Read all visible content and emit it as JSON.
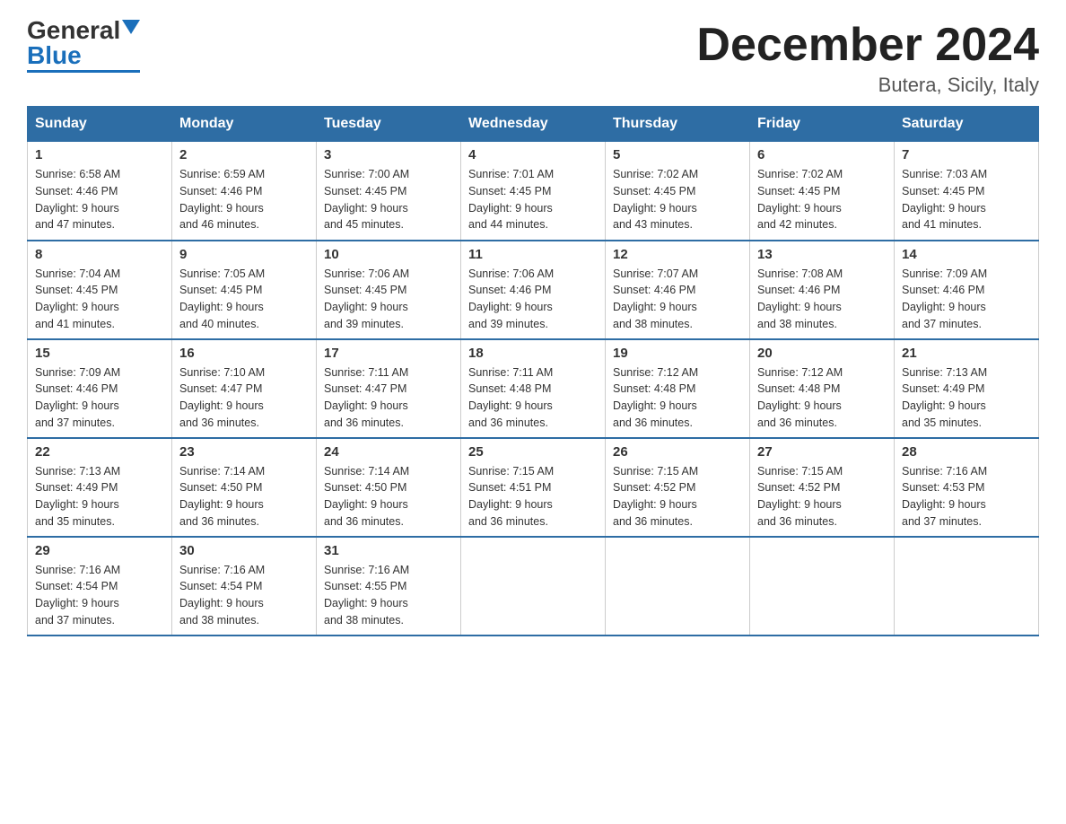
{
  "logo": {
    "general": "General",
    "blue": "Blue"
  },
  "title": "December 2024",
  "subtitle": "Butera, Sicily, Italy",
  "days": [
    "Sunday",
    "Monday",
    "Tuesday",
    "Wednesday",
    "Thursday",
    "Friday",
    "Saturday"
  ],
  "weeks": [
    [
      {
        "num": "1",
        "sunrise": "6:58 AM",
        "sunset": "4:46 PM",
        "daylight": "9 hours and 47 minutes."
      },
      {
        "num": "2",
        "sunrise": "6:59 AM",
        "sunset": "4:46 PM",
        "daylight": "9 hours and 46 minutes."
      },
      {
        "num": "3",
        "sunrise": "7:00 AM",
        "sunset": "4:45 PM",
        "daylight": "9 hours and 45 minutes."
      },
      {
        "num": "4",
        "sunrise": "7:01 AM",
        "sunset": "4:45 PM",
        "daylight": "9 hours and 44 minutes."
      },
      {
        "num": "5",
        "sunrise": "7:02 AM",
        "sunset": "4:45 PM",
        "daylight": "9 hours and 43 minutes."
      },
      {
        "num": "6",
        "sunrise": "7:02 AM",
        "sunset": "4:45 PM",
        "daylight": "9 hours and 42 minutes."
      },
      {
        "num": "7",
        "sunrise": "7:03 AM",
        "sunset": "4:45 PM",
        "daylight": "9 hours and 41 minutes."
      }
    ],
    [
      {
        "num": "8",
        "sunrise": "7:04 AM",
        "sunset": "4:45 PM",
        "daylight": "9 hours and 41 minutes."
      },
      {
        "num": "9",
        "sunrise": "7:05 AM",
        "sunset": "4:45 PM",
        "daylight": "9 hours and 40 minutes."
      },
      {
        "num": "10",
        "sunrise": "7:06 AM",
        "sunset": "4:45 PM",
        "daylight": "9 hours and 39 minutes."
      },
      {
        "num": "11",
        "sunrise": "7:06 AM",
        "sunset": "4:46 PM",
        "daylight": "9 hours and 39 minutes."
      },
      {
        "num": "12",
        "sunrise": "7:07 AM",
        "sunset": "4:46 PM",
        "daylight": "9 hours and 38 minutes."
      },
      {
        "num": "13",
        "sunrise": "7:08 AM",
        "sunset": "4:46 PM",
        "daylight": "9 hours and 38 minutes."
      },
      {
        "num": "14",
        "sunrise": "7:09 AM",
        "sunset": "4:46 PM",
        "daylight": "9 hours and 37 minutes."
      }
    ],
    [
      {
        "num": "15",
        "sunrise": "7:09 AM",
        "sunset": "4:46 PM",
        "daylight": "9 hours and 37 minutes."
      },
      {
        "num": "16",
        "sunrise": "7:10 AM",
        "sunset": "4:47 PM",
        "daylight": "9 hours and 36 minutes."
      },
      {
        "num": "17",
        "sunrise": "7:11 AM",
        "sunset": "4:47 PM",
        "daylight": "9 hours and 36 minutes."
      },
      {
        "num": "18",
        "sunrise": "7:11 AM",
        "sunset": "4:48 PM",
        "daylight": "9 hours and 36 minutes."
      },
      {
        "num": "19",
        "sunrise": "7:12 AM",
        "sunset": "4:48 PM",
        "daylight": "9 hours and 36 minutes."
      },
      {
        "num": "20",
        "sunrise": "7:12 AM",
        "sunset": "4:48 PM",
        "daylight": "9 hours and 36 minutes."
      },
      {
        "num": "21",
        "sunrise": "7:13 AM",
        "sunset": "4:49 PM",
        "daylight": "9 hours and 35 minutes."
      }
    ],
    [
      {
        "num": "22",
        "sunrise": "7:13 AM",
        "sunset": "4:49 PM",
        "daylight": "9 hours and 35 minutes."
      },
      {
        "num": "23",
        "sunrise": "7:14 AM",
        "sunset": "4:50 PM",
        "daylight": "9 hours and 36 minutes."
      },
      {
        "num": "24",
        "sunrise": "7:14 AM",
        "sunset": "4:50 PM",
        "daylight": "9 hours and 36 minutes."
      },
      {
        "num": "25",
        "sunrise": "7:15 AM",
        "sunset": "4:51 PM",
        "daylight": "9 hours and 36 minutes."
      },
      {
        "num": "26",
        "sunrise": "7:15 AM",
        "sunset": "4:52 PM",
        "daylight": "9 hours and 36 minutes."
      },
      {
        "num": "27",
        "sunrise": "7:15 AM",
        "sunset": "4:52 PM",
        "daylight": "9 hours and 36 minutes."
      },
      {
        "num": "28",
        "sunrise": "7:16 AM",
        "sunset": "4:53 PM",
        "daylight": "9 hours and 37 minutes."
      }
    ],
    [
      {
        "num": "29",
        "sunrise": "7:16 AM",
        "sunset": "4:54 PM",
        "daylight": "9 hours and 37 minutes."
      },
      {
        "num": "30",
        "sunrise": "7:16 AM",
        "sunset": "4:54 PM",
        "daylight": "9 hours and 38 minutes."
      },
      {
        "num": "31",
        "sunrise": "7:16 AM",
        "sunset": "4:55 PM",
        "daylight": "9 hours and 38 minutes."
      },
      null,
      null,
      null,
      null
    ]
  ],
  "labels": {
    "sunrise": "Sunrise:",
    "sunset": "Sunset:",
    "daylight": "Daylight:"
  }
}
